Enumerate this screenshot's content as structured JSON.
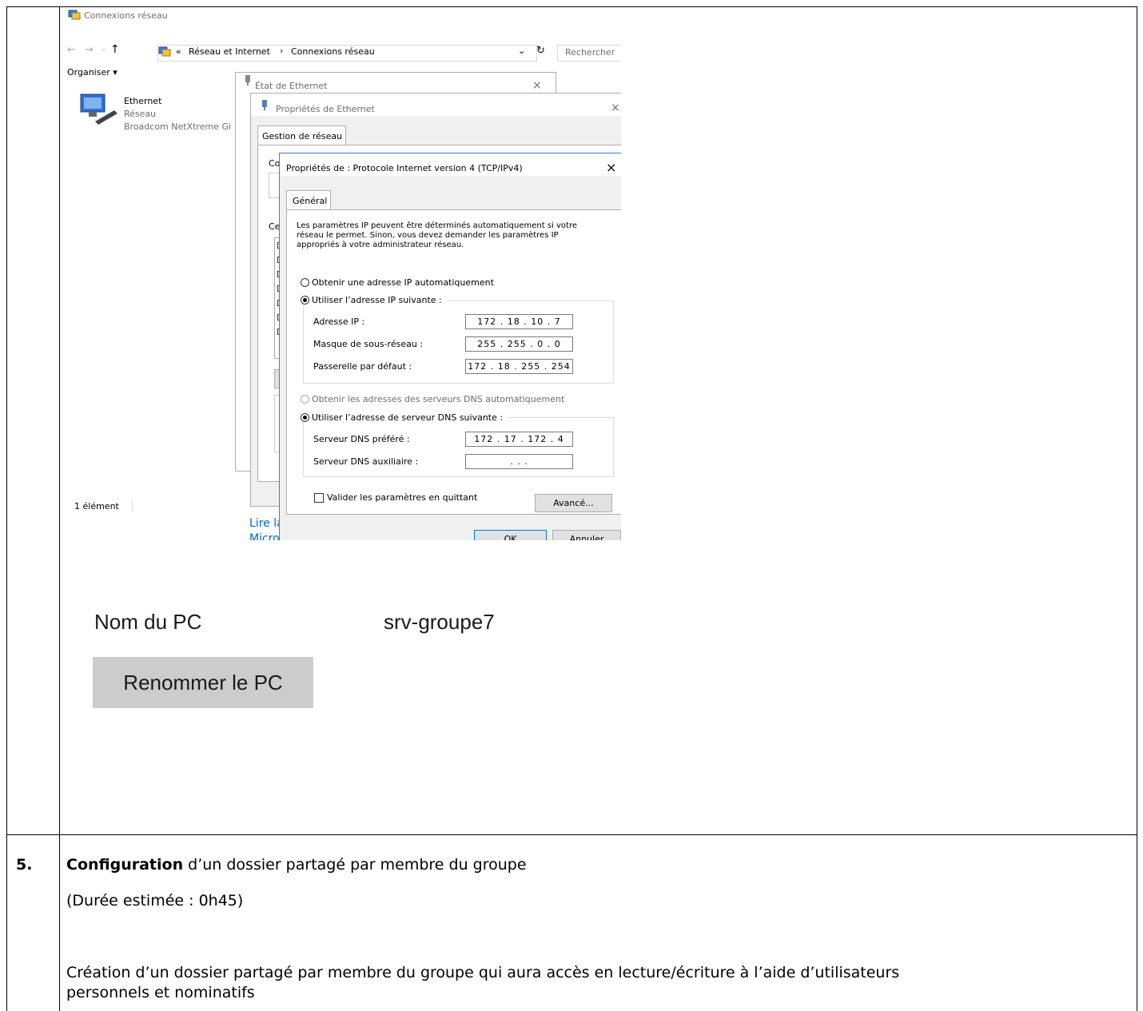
{
  "explorer": {
    "window_title": "Connexions réseau",
    "breadcrumb_sep_left": "«",
    "breadcrumb_1": "Réseau et Internet",
    "breadcrumb_arrow": "›",
    "breadcrumb_2": "Connexions réseau",
    "search_placeholder": "Rechercher",
    "organize": "Organiser ▾",
    "item_name": "Ethernet",
    "item_type": "Réseau",
    "item_device": "Broadcom NetXtreme Gi",
    "status_count": "1 élément",
    "partial_link_1": "Lire la",
    "partial_link_2": "Micro"
  },
  "etat_dialog": {
    "title": "État de Ethernet"
  },
  "eth_props": {
    "title": "Propriétés de Ethernet",
    "tab": "Gestion de réseau",
    "partial_conn": "Co",
    "partial_ce": "Ce"
  },
  "ipv4": {
    "title": "Propriétés de : Protocole Internet version 4 (TCP/IPv4)",
    "tab": "Général",
    "intro": [
      "Les paramètres IP peuvent être déterminés automatiquement si votre",
      "réseau le permet. Sinon, vous devez demander les paramètres IP",
      "appropriés à votre administrateur réseau."
    ],
    "radio_auto_ip": "Obtenir une adresse IP automatiquement",
    "radio_manual_ip": "Utiliser l’adresse IP suivante :",
    "ip_label": "Adresse IP :",
    "ip_value": "172 .  18  .  10  .  7",
    "mask_label": "Masque de sous-réseau :",
    "mask_value": "255 . 255 .  0  .  0",
    "gw_label": "Passerelle par défaut :",
    "gw_value": "172 .  18  . 255 . 254",
    "radio_auto_dns": "Obtenir les adresses des serveurs DNS automatiquement",
    "radio_manual_dns": "Utiliser l’adresse de serveur DNS suivante :",
    "dns1_label": "Serveur DNS préféré :",
    "dns1_value": "172 .  17  . 172 .  4",
    "dns2_label": "Serveur DNS auxiliaire :",
    "dns2_value": ".       .       .",
    "validate_label": "Valider les paramètres en quittant",
    "advanced": "Avancé...",
    "ok": "OK",
    "cancel": "Annuler"
  },
  "pc": {
    "name_label": "Nom du PC",
    "name_value": "srv-groupe7",
    "rename_button": "Renommer le PC"
  },
  "step5": {
    "number": "5.",
    "title_bold": "Configuration",
    "title_rest": " d’un dossier partagé par membre du groupe",
    "duration": "(Durée estimée : 0h45)",
    "desc_line1": "Création d’un dossier partagé par membre du groupe qui aura accès en lecture/écriture à l’aide d’utilisateurs",
    "desc_line2": "personnels et nominatifs"
  }
}
